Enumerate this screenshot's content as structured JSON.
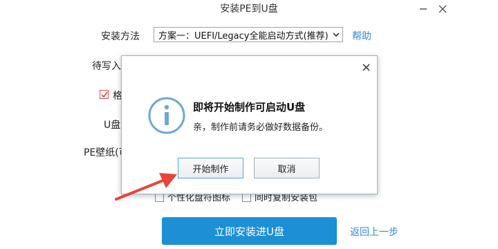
{
  "window": {
    "title": "安装PE到U盘",
    "minimize_icon": "minimize-icon",
    "close_icon": "close-icon"
  },
  "form": {
    "install_method_label": "安装方法",
    "install_method_value": "方案一：UEFI/Legacy全能启动方式(推荐)",
    "help_link": "帮助",
    "write_label_partial": "待写入",
    "format_label_partial": "格",
    "format_checked": true,
    "udisk_label_partial": "U盘",
    "wallpaper_label_partial": "PE壁纸(可",
    "personalize_icon_label_partial": "个性化盘符图标",
    "copy_install_pkg_label_partial": "同时复制安装包"
  },
  "actions": {
    "install_button": "立即安装进U盘",
    "back_link": "返回上一步"
  },
  "dialog": {
    "title": "即将开始制作可启动U盘",
    "message": "亲，制作前请务必做好数据备份。",
    "start_button": "开始制作",
    "cancel_button": "取消",
    "icon": "info-icon"
  },
  "colors": {
    "accent": "#1c8fd5",
    "link": "#2e8ad8",
    "annotation_arrow": "#e8453c"
  }
}
